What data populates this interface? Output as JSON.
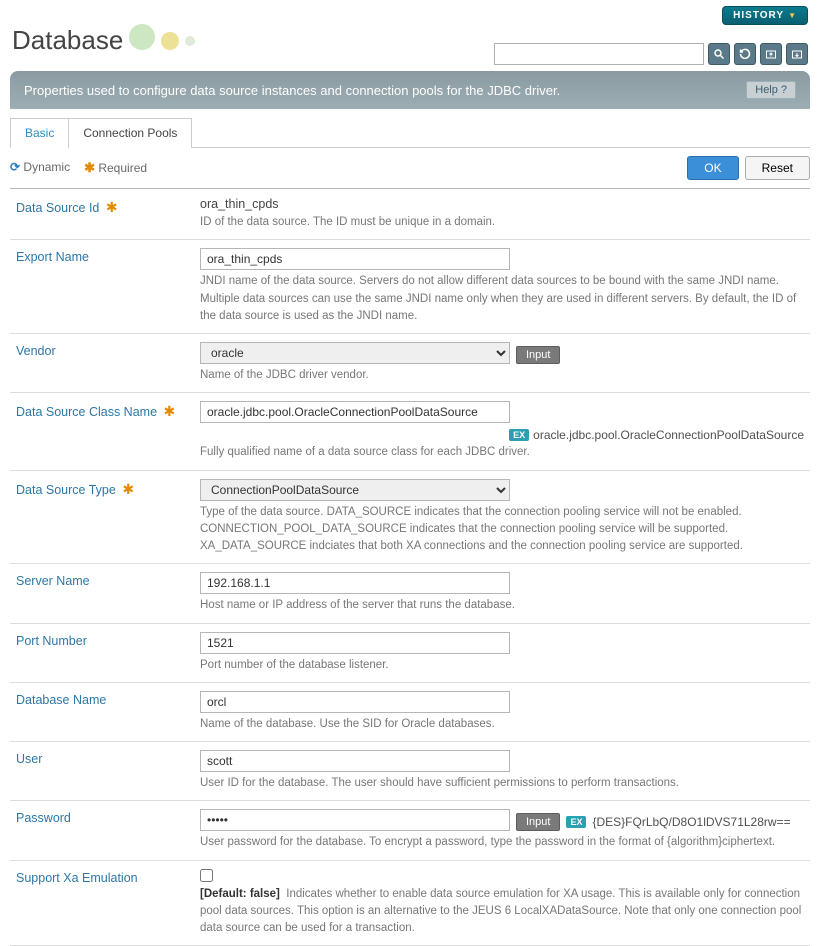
{
  "header": {
    "history_label": "HISTORY",
    "title": "Database",
    "description": "Properties used to configure data source instances and connection pools for the JDBC driver.",
    "help_label": "Help"
  },
  "tabs": {
    "basic": "Basic",
    "connection_pools": "Connection Pools"
  },
  "legend": {
    "dynamic": "Dynamic",
    "required": "Required"
  },
  "buttons": {
    "ok": "OK",
    "reset": "Reset",
    "input": "Input"
  },
  "form": {
    "data_source_id": {
      "label": "Data Source Id",
      "value": "ora_thin_cpds",
      "desc": "ID of the data source. The ID must be unique in a domain."
    },
    "export_name": {
      "label": "Export Name",
      "value": "ora_thin_cpds",
      "desc": "JNDI name of the data source. Servers do not allow different data sources to be bound with the same JNDI name. Multiple data sources can use the same JNDI name only when they are used in different servers. By default, the ID of the data source is used as the JNDI name."
    },
    "vendor": {
      "label": "Vendor",
      "value": "oracle",
      "desc": "Name of the JDBC driver vendor."
    },
    "ds_class": {
      "label": "Data Source Class Name",
      "value": "oracle.jdbc.pool.OracleConnectionPoolDataSource",
      "hint_label": "EX",
      "hint_text": "oracle.jdbc.pool.OracleConnectionPoolDataSource",
      "desc": "Fully qualified name of a data source class for each JDBC driver."
    },
    "ds_type": {
      "label": "Data Source Type",
      "value": "ConnectionPoolDataSource",
      "desc": "Type of the data source. DATA_SOURCE indicates that the connection pooling service will not be enabled. CONNECTION_POOL_DATA_SOURCE indicates that the connection pooling service will be supported. XA_DATA_SOURCE indciates that both XA connections and the connection pooling service are supported."
    },
    "server_name": {
      "label": "Server Name",
      "value": "192.168.1.1",
      "desc": "Host name or IP address of the server that runs the database."
    },
    "port_number": {
      "label": "Port Number",
      "value": "1521",
      "desc": "Port number of the database listener."
    },
    "database_name": {
      "label": "Database Name",
      "value": "orcl",
      "desc": "Name of the database. Use the SID for Oracle databases."
    },
    "user": {
      "label": "User",
      "value": "scott",
      "desc": "User ID for the database. The user should have sufficient permissions to perform transactions."
    },
    "password": {
      "label": "Password",
      "value": "•••••",
      "hint_label": "EX",
      "hint_text": "{DES}FQrLbQ/D8O1lDVS71L28rw==",
      "desc": "User password for the database. To encrypt a password, type the password in the format of {algorithm}ciphertext."
    },
    "xa_emulation": {
      "label": "Support Xa Emulation",
      "default_tag": "[Default: false]",
      "desc": "Indicates whether to enable data source emulation for XA usage. This is available only for connection pool data sources. This option is an alternative to the JEUS 6 LocalXADataSource. Note that only one connection pool data source can be used for a transaction."
    }
  }
}
